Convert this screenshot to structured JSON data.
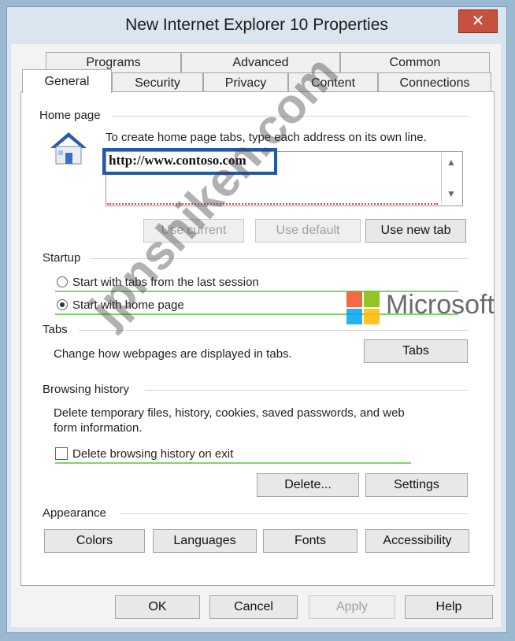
{
  "window": {
    "title": "New Internet Explorer 10 Properties",
    "close_glyph": "✕"
  },
  "tabs_row_back": [
    "Programs",
    "Advanced",
    "Common"
  ],
  "tabs_row_front": [
    "General",
    "Security",
    "Privacy",
    "Content",
    "Connections"
  ],
  "active_tab": "General",
  "home_page": {
    "section": "Home page",
    "instruction": "To create home page tabs, type each address on its own line.",
    "url": "http://www.contoso.com",
    "buttons": {
      "use_current": "Use current",
      "use_default": "Use default",
      "use_new_tab": "Use new tab"
    }
  },
  "startup": {
    "section": "Startup",
    "options": [
      "Start with tabs from the last session",
      "Start with home page"
    ],
    "selected": "Start with home page"
  },
  "tabs_section": {
    "section": "Tabs",
    "description": "Change how webpages are displayed in tabs.",
    "button": "Tabs"
  },
  "browsing_history": {
    "section": "Browsing history",
    "description_line1": "Delete temporary files, history, cookies, saved passwords, and web",
    "description_line2": "form information.",
    "checkbox_label": "Delete browsing history on exit",
    "checkbox_checked": false,
    "buttons": {
      "delete": "Delete...",
      "settings": "Settings"
    }
  },
  "appearance": {
    "section": "Appearance",
    "buttons": [
      "Colors",
      "Languages",
      "Fonts",
      "Accessibility"
    ]
  },
  "dialog_buttons": {
    "ok": "OK",
    "cancel": "Cancel",
    "apply": "Apply",
    "help": "Help"
  },
  "overlay": {
    "brand": "Microsoft",
    "watermark": "jpnshiken.com"
  },
  "colors": {
    "highlight_border": "#2457a8",
    "close_red": "#c7513f",
    "ms_red": "#f25022",
    "ms_green": "#7fba00",
    "ms_blue": "#00a4ef",
    "ms_yellow": "#ffb900"
  }
}
